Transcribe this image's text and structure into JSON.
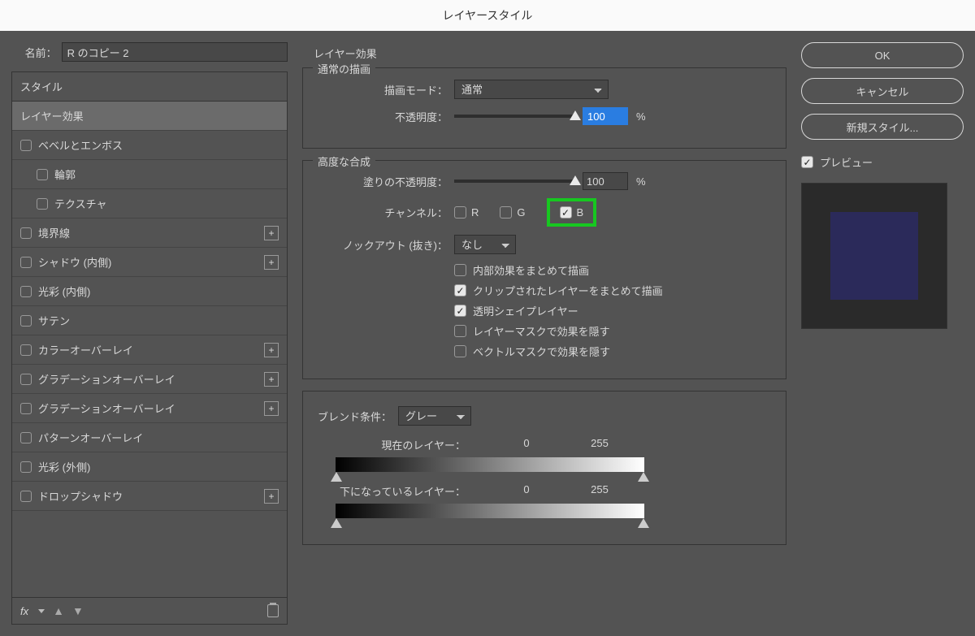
{
  "title": "レイヤースタイル",
  "name_label": "名前：",
  "name_value": "R のコピー 2",
  "styles_header": "スタイル",
  "styles": [
    {
      "label": "レイヤー効果",
      "selected": true,
      "checkbox": false,
      "plus": false,
      "indent": 0
    },
    {
      "label": "ベベルとエンボス",
      "checkbox": true,
      "plus": false,
      "indent": 0
    },
    {
      "label": "輪郭",
      "checkbox": true,
      "plus": false,
      "indent": 1
    },
    {
      "label": "テクスチャ",
      "checkbox": true,
      "plus": false,
      "indent": 1
    },
    {
      "label": "境界線",
      "checkbox": true,
      "plus": true,
      "indent": 0
    },
    {
      "label": "シャドウ (内側)",
      "checkbox": true,
      "plus": true,
      "indent": 0
    },
    {
      "label": "光彩 (内側)",
      "checkbox": true,
      "plus": false,
      "indent": 0
    },
    {
      "label": "サテン",
      "checkbox": true,
      "plus": false,
      "indent": 0
    },
    {
      "label": "カラーオーバーレイ",
      "checkbox": true,
      "plus": true,
      "indent": 0
    },
    {
      "label": "グラデーションオーバーレイ",
      "checkbox": true,
      "plus": true,
      "indent": 0
    },
    {
      "label": "グラデーションオーバーレイ",
      "checkbox": true,
      "plus": true,
      "indent": 0
    },
    {
      "label": "パターンオーバーレイ",
      "checkbox": true,
      "plus": false,
      "indent": 0
    },
    {
      "label": "光彩 (外側)",
      "checkbox": true,
      "plus": false,
      "indent": 0
    },
    {
      "label": "ドロップシャドウ",
      "checkbox": true,
      "plus": true,
      "indent": 0
    }
  ],
  "mid_title": "レイヤー効果",
  "group_normal": {
    "title": "通常の描画",
    "mode_label": "描画モード：",
    "mode_value": "通常",
    "opacity_label": "不透明度：",
    "opacity_value": "100",
    "pct": "%"
  },
  "group_adv": {
    "title": "高度な合成",
    "fill_label": "塗りの不透明度：",
    "fill_value": "100",
    "pct": "%",
    "channel_label": "チャンネル：",
    "ch_r": "R",
    "ch_g": "G",
    "ch_b": "B",
    "knock_label": "ノックアウト (抜き)：",
    "knock_value": "なし",
    "opts": [
      {
        "label": "内部効果をまとめて描画",
        "checked": false
      },
      {
        "label": "クリップされたレイヤーをまとめて描画",
        "checked": true
      },
      {
        "label": "透明シェイプレイヤー",
        "checked": true
      },
      {
        "label": "レイヤーマスクで効果を隠す",
        "checked": false
      },
      {
        "label": "ベクトルマスクで効果を隠す",
        "checked": false
      }
    ]
  },
  "group_blend": {
    "title": "ブレンド条件：",
    "value": "グレー",
    "this_label": "現在のレイヤー：",
    "this_lo": "0",
    "this_hi": "255",
    "under_label": "下になっているレイヤー：",
    "under_lo": "0",
    "under_hi": "255"
  },
  "right": {
    "ok": "OK",
    "cancel": "キャンセル",
    "newstyle": "新規スタイル...",
    "preview": "プレビュー"
  }
}
